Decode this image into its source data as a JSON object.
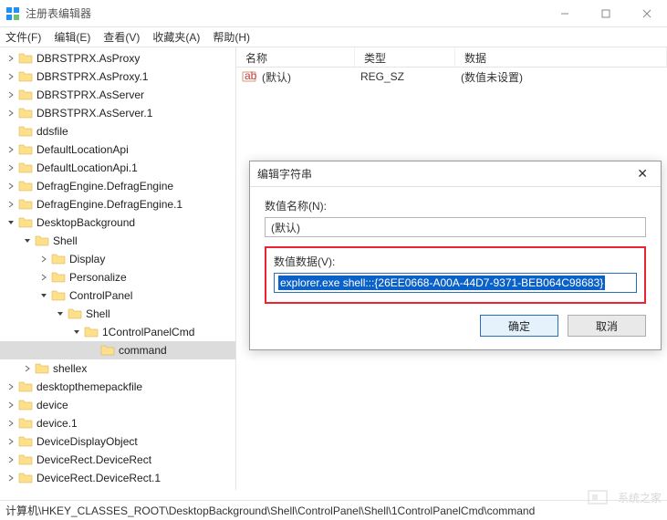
{
  "window": {
    "title": "注册表编辑器",
    "minimize": "—",
    "maximize": "□",
    "close": "×"
  },
  "menu": {
    "file": "文件(F)",
    "edit": "编辑(E)",
    "view": "查看(V)",
    "favorites": "收藏夹(A)",
    "help": "帮助(H)"
  },
  "tree": [
    {
      "depth": 0,
      "exp": ">",
      "label": "DBRSTPRX.AsProxy"
    },
    {
      "depth": 0,
      "exp": ">",
      "label": "DBRSTPRX.AsProxy.1"
    },
    {
      "depth": 0,
      "exp": ">",
      "label": "DBRSTPRX.AsServer"
    },
    {
      "depth": 0,
      "exp": ">",
      "label": "DBRSTPRX.AsServer.1"
    },
    {
      "depth": 0,
      "exp": "",
      "label": "ddsfile"
    },
    {
      "depth": 0,
      "exp": ">",
      "label": "DefaultLocationApi"
    },
    {
      "depth": 0,
      "exp": ">",
      "label": "DefaultLocationApi.1"
    },
    {
      "depth": 0,
      "exp": ">",
      "label": "DefragEngine.DefragEngine"
    },
    {
      "depth": 0,
      "exp": ">",
      "label": "DefragEngine.DefragEngine.1"
    },
    {
      "depth": 0,
      "exp": "v",
      "label": "DesktopBackground"
    },
    {
      "depth": 1,
      "exp": "v",
      "label": "Shell"
    },
    {
      "depth": 2,
      "exp": ">",
      "label": "Display"
    },
    {
      "depth": 2,
      "exp": ">",
      "label": "Personalize"
    },
    {
      "depth": 2,
      "exp": "v",
      "label": "ControlPanel"
    },
    {
      "depth": 3,
      "exp": "v",
      "label": "Shell"
    },
    {
      "depth": 4,
      "exp": "v",
      "label": "1ControlPanelCmd"
    },
    {
      "depth": 5,
      "exp": "",
      "label": "command",
      "selected": true
    },
    {
      "depth": 1,
      "exp": ">",
      "label": "shellex"
    },
    {
      "depth": 0,
      "exp": ">",
      "label": "desktopthemepackfile"
    },
    {
      "depth": 0,
      "exp": ">",
      "label": "device"
    },
    {
      "depth": 0,
      "exp": ">",
      "label": "device.1"
    },
    {
      "depth": 0,
      "exp": ">",
      "label": "DeviceDisplayObject"
    },
    {
      "depth": 0,
      "exp": ">",
      "label": "DeviceRect.DeviceRect"
    },
    {
      "depth": 0,
      "exp": ">",
      "label": "DeviceRect.DeviceRect.1"
    }
  ],
  "list": {
    "headers": {
      "name": "名称",
      "type": "类型",
      "data": "数据"
    },
    "rows": [
      {
        "icon": "ab",
        "name": "(默认)",
        "type": "REG_SZ",
        "data": "(数值未设置)"
      }
    ]
  },
  "dialog": {
    "title": "编辑字符串",
    "name_label": "数值名称(N):",
    "name_value": "(默认)",
    "data_label": "数值数据(V):",
    "data_value": "explorer.exe shell:::{26EE0668-A00A-44D7-9371-BEB064C98683}",
    "ok": "确定",
    "cancel": "取消"
  },
  "status": "计算机\\HKEY_CLASSES_ROOT\\DesktopBackground\\Shell\\ControlPanel\\Shell\\1ControlPanelCmd\\command",
  "watermark": "系统之家"
}
